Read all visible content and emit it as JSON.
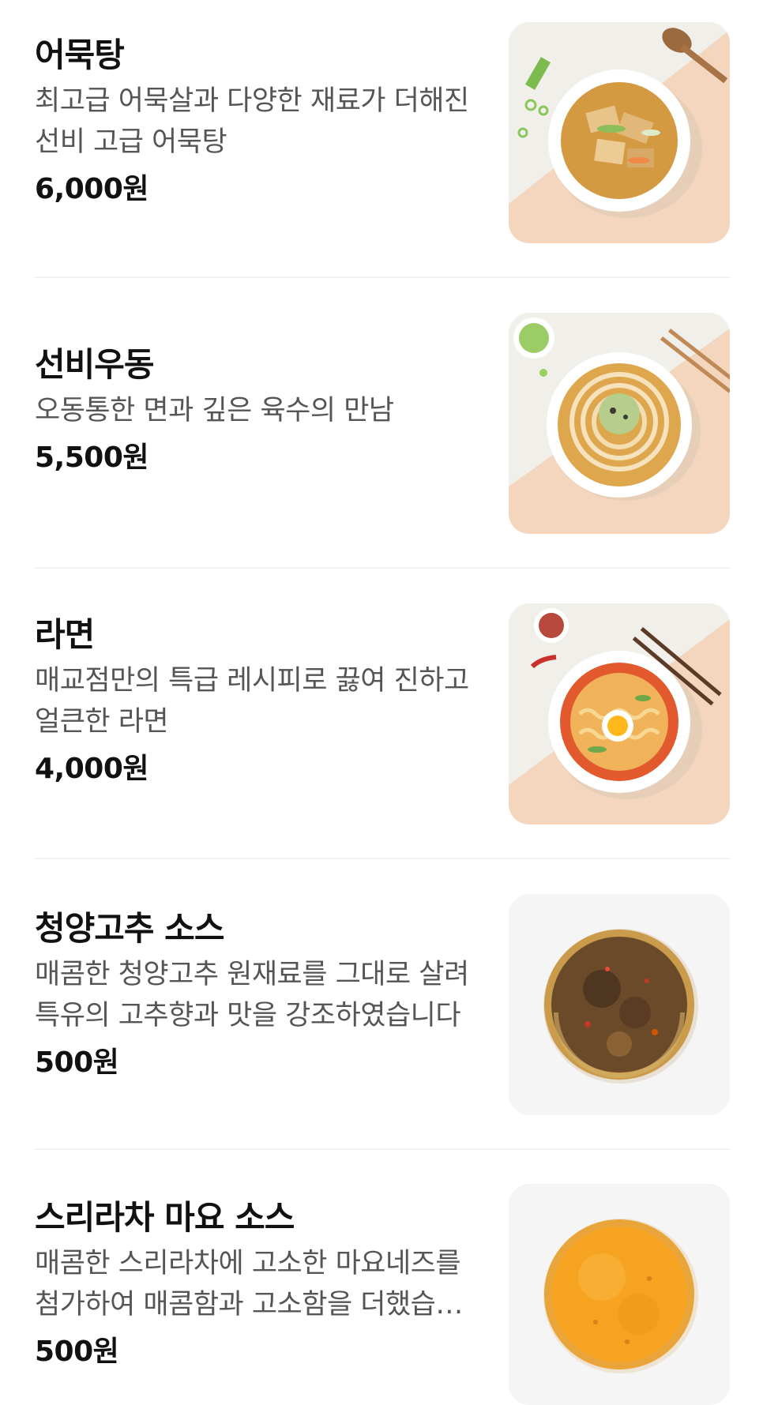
{
  "menu": {
    "items": [
      {
        "name": "어묵탕",
        "description": "최고급 어묵살과 다양한 재료가 더해진 선비 고급 어묵탕",
        "price": "6,000원",
        "image": "fishcake-soup-photo"
      },
      {
        "name": "선비우동",
        "description": "오동통한 면과 깊은 육수의 만남",
        "price": "5,500원",
        "image": "udon-photo"
      },
      {
        "name": "라면",
        "description": "매교점만의 특급 레시피로 끓여 진하고 얼큰한 라면",
        "price": "4,000원",
        "image": "ramen-photo"
      },
      {
        "name": "청양고추 소스",
        "description": "매콤한 청양고추 원재료를 그대로 살려 특유의 고추향과 맛을 강조하였습니다",
        "price": "500원",
        "image": "cheongyang-pepper-sauce-photo"
      },
      {
        "name": "스리라차 마요 소스",
        "description": "매콤한 스리라차에 고소한 마요네즈를 첨가하여 매콤함과 고소함을 더했습니다",
        "price": "500원",
        "image": "sriracha-mayo-sauce-photo"
      }
    ]
  }
}
